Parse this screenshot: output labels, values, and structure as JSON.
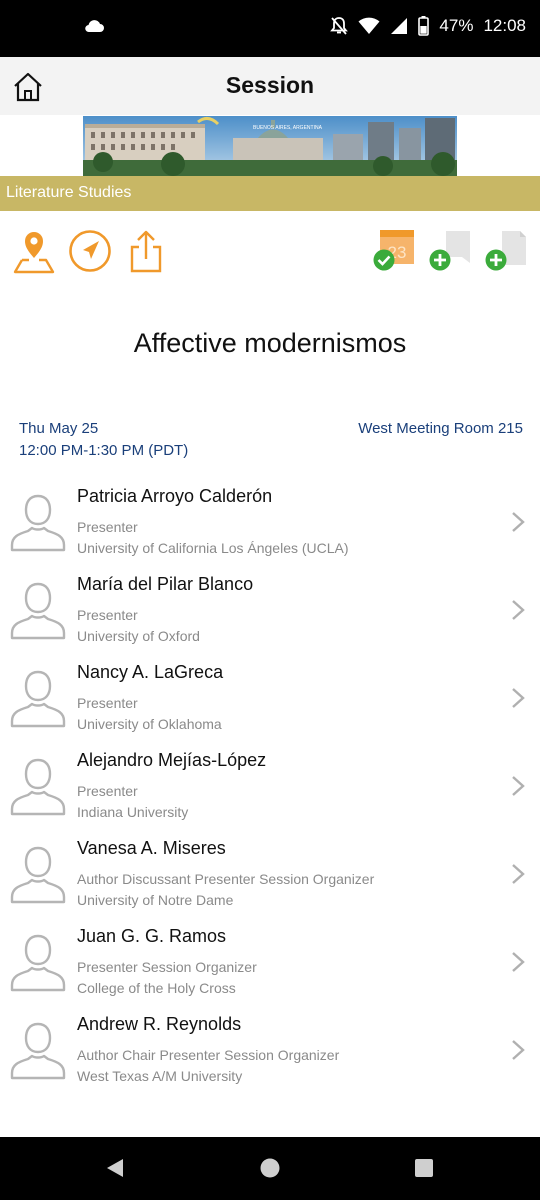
{
  "status": {
    "battery": "47%",
    "time": "12:08",
    "icons": [
      "cloud-icon",
      "mute-icon",
      "wifi-icon",
      "signal-icon",
      "battery-icon"
    ]
  },
  "header": {
    "title": "Session",
    "home_icon": "home-icon"
  },
  "banner": {
    "caption": "BUENOS AIRES, ARGENTINA"
  },
  "track": {
    "label": "Literature Studies"
  },
  "toolbar": {
    "left_icons": [
      "map-pin-icon",
      "navigate-icon",
      "share-icon"
    ],
    "right_icons": [
      "calendar-added-icon",
      "add-note-icon",
      "add-document-icon"
    ],
    "calendar_day": "23",
    "accent": "#f0992b",
    "green": "#3bab3b"
  },
  "session": {
    "title": "Affective modernismos",
    "date": "Thu May 25",
    "time": "12:00 PM-1:30 PM (PDT)",
    "room": "West Meeting Room 215"
  },
  "people": [
    {
      "name": "Patricia Arroyo Calderón",
      "role": "Presenter",
      "org": "University of California Los Ángeles (UCLA)"
    },
    {
      "name": "María del Pilar Blanco",
      "role": "Presenter",
      "org": "University of Oxford"
    },
    {
      "name": "Nancy A. LaGreca",
      "role": "Presenter",
      "org": "University of Oklahoma"
    },
    {
      "name": "Alejandro Mejías-López",
      "role": "Presenter",
      "org": "Indiana University"
    },
    {
      "name": "Vanesa A. Miseres",
      "role": "Author Discussant Presenter Session Organizer",
      "org": "University of Notre Dame"
    },
    {
      "name": "Juan G. G. Ramos",
      "role": "Presenter Session Organizer",
      "org": "College of the Holy Cross"
    },
    {
      "name": "Andrew R. Reynolds",
      "role": "Author Chair Presenter Session Organizer",
      "org": "West Texas A/M University"
    }
  ],
  "navbar": {
    "icons": [
      "back-icon",
      "home-circle-icon",
      "recents-icon"
    ]
  }
}
